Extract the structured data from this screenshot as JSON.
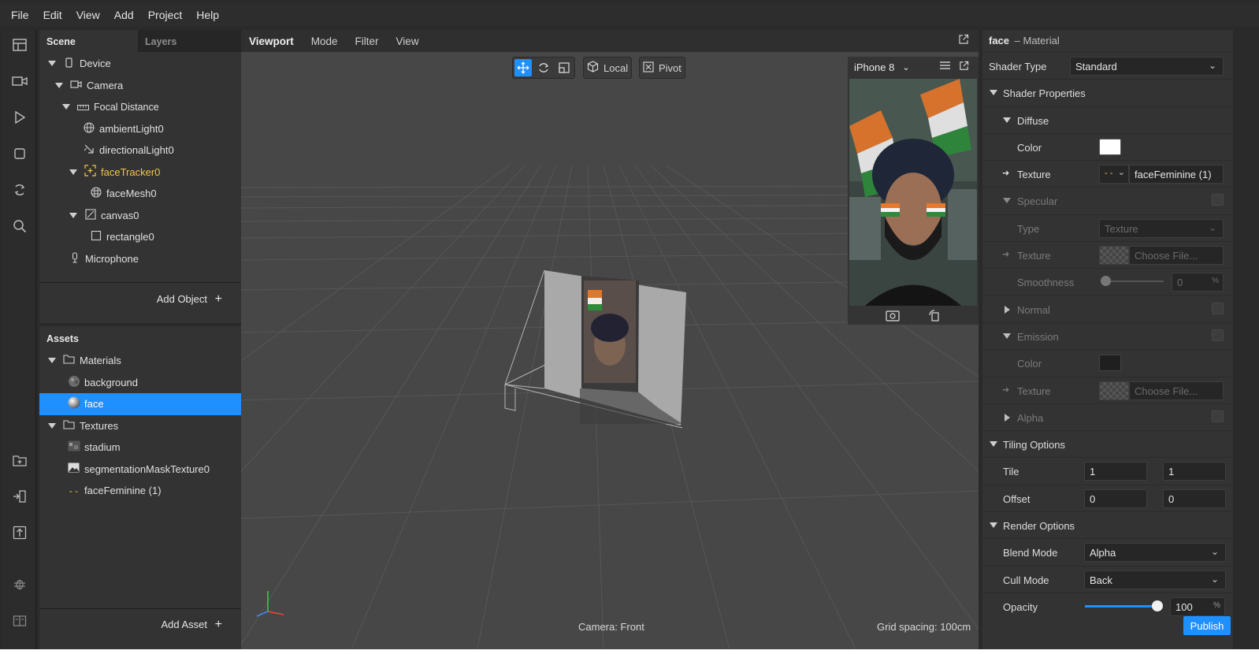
{
  "menu": [
    "File",
    "Edit",
    "View",
    "Add",
    "Project",
    "Help"
  ],
  "scene_tabs": {
    "scene": "Scene",
    "layers": "Layers"
  },
  "scene_tree": [
    {
      "label": "Device",
      "icon": "phone-icon"
    },
    {
      "label": "Camera",
      "icon": "camera-icon"
    },
    {
      "label": "Focal Distance",
      "icon": "ruler-icon"
    },
    {
      "label": "ambientLight0",
      "icon": "globe-icon"
    },
    {
      "label": "directionalLight0",
      "icon": "light-icon"
    },
    {
      "label": "faceTracker0",
      "icon": "face-tracker-icon"
    },
    {
      "label": "faceMesh0",
      "icon": "mesh-icon"
    },
    {
      "label": "canvas0",
      "icon": "canvas-icon"
    },
    {
      "label": "rectangle0",
      "icon": "rectangle-icon"
    },
    {
      "label": "Microphone",
      "icon": "microphone-icon"
    }
  ],
  "add_object": "Add Object",
  "assets_title": "Assets",
  "assets": [
    {
      "label": "Materials",
      "icon": "folder-icon"
    },
    {
      "label": "background",
      "icon": "material-icon"
    },
    {
      "label": "face",
      "icon": "sphere-icon"
    },
    {
      "label": "Textures",
      "icon": "folder-icon"
    },
    {
      "label": "stadium",
      "icon": "texture-icon"
    },
    {
      "label": "segmentationMaskTexture0",
      "icon": "image-icon"
    },
    {
      "label": "faceFeminine (1)",
      "icon": "dash-icon"
    }
  ],
  "add_asset": "Add Asset",
  "viewport_tabs": [
    "Viewport",
    "Mode",
    "Filter",
    "View"
  ],
  "viewport_toolbar": {
    "local": "Local",
    "pivot": "Pivot"
  },
  "camera_label": "Camera: Front",
  "grid_spacing": "Grid spacing: 100cm",
  "simulator": {
    "device": "iPhone 8"
  },
  "inspector": {
    "name": "face",
    "type": "– Material",
    "shader_type_label": "Shader Type",
    "shader_type_value": "Standard",
    "shader_properties": "Shader Properties",
    "diffuse": "Diffuse",
    "color": "Color",
    "texture": "Texture",
    "diffuse_texture_value": "faceFeminine (1)",
    "specular": "Specular",
    "type_label": "Type",
    "type_value": "Texture",
    "choose_file": "Choose File...",
    "smoothness": "Smoothness",
    "smoothness_value": "0",
    "percent": "%",
    "normal": "Normal",
    "emission": "Emission",
    "alpha": "Alpha",
    "tiling_options": "Tiling Options",
    "tile": "Tile",
    "tile_x": "1",
    "tile_y": "1",
    "offset": "Offset",
    "offset_x": "0",
    "offset_y": "0",
    "render_options": "Render Options",
    "blend_mode": "Blend Mode",
    "blend_mode_value": "Alpha",
    "cull_mode": "Cull Mode",
    "cull_mode_value": "Back",
    "opacity": "Opacity",
    "opacity_value": "100",
    "opacity_fraction": 1.0
  },
  "publish": "Publish",
  "colors": {
    "accent": "#1e90ff",
    "selection_text": "#ffffff",
    "face_tracker": "#f2c744",
    "diffuse_color": "#ffffff",
    "emission_color": "#1f1f1f"
  }
}
